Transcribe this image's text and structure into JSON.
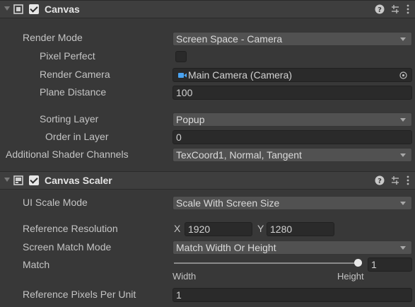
{
  "canvas": {
    "title": "Canvas",
    "render_mode": {
      "label": "Render Mode",
      "value": "Screen Space - Camera"
    },
    "pixel_perfect": {
      "label": "Pixel Perfect",
      "checked": false
    },
    "render_camera": {
      "label": "Render Camera",
      "value": "Main Camera (Camera)"
    },
    "plane_distance": {
      "label": "Plane Distance",
      "value": "100"
    },
    "sorting_layer": {
      "label": "Sorting Layer",
      "value": "Popup"
    },
    "order_in_layer": {
      "label": "Order in Layer",
      "value": "0"
    },
    "additional_shader_channels": {
      "label": "Additional Shader Channels",
      "value": "TexCoord1, Normal, Tangent"
    }
  },
  "canvas_scaler": {
    "title": "Canvas Scaler",
    "ui_scale_mode": {
      "label": "UI Scale Mode",
      "value": "Scale With Screen Size"
    },
    "reference_resolution": {
      "label": "Reference Resolution",
      "x_label": "X",
      "x_value": "1920",
      "y_label": "Y",
      "y_value": "1280"
    },
    "screen_match_mode": {
      "label": "Screen Match Mode",
      "value": "Match Width Or Height"
    },
    "match": {
      "label": "Match",
      "value": "1",
      "fraction": 1.0,
      "min_label": "Width",
      "max_label": "Height"
    },
    "reference_pixels_per_unit": {
      "label": "Reference Pixels Per Unit",
      "value": "1"
    }
  },
  "icons": [
    "fold-arrow-icon",
    "canvas-component-icon",
    "canvas-scaler-component-icon",
    "help-icon",
    "presets-icon",
    "kebab-menu-icon",
    "camera-icon",
    "object-picker-icon",
    "dropdown-caret-icon"
  ],
  "colors": {
    "background": "#383838",
    "header": "#3e3e3e",
    "field": "#2a2a2a",
    "dropdown": "#515151",
    "camera_icon": "#4aa3f0"
  }
}
